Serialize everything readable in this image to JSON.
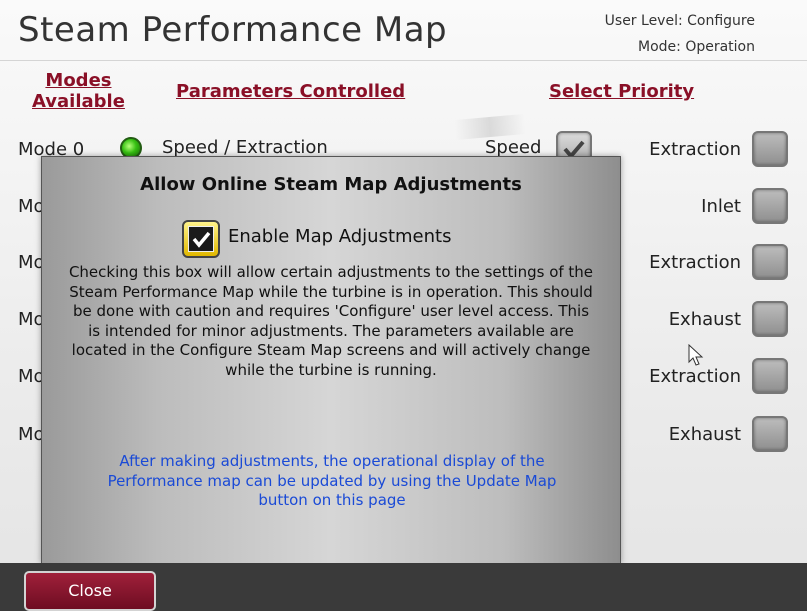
{
  "header": {
    "title": "Steam Performance Map",
    "user_level": "User Level: Configure",
    "mode": "Mode: Operation"
  },
  "columns": {
    "modes_line1": "Modes",
    "modes_line2": "Available",
    "parameters": "Parameters Controlled",
    "priority": "Select Priority"
  },
  "rows": [
    {
      "label": "Mode 0",
      "parameters": "Speed / Extraction",
      "speed": "Speed",
      "priority": "Extraction"
    },
    {
      "label": "Mo",
      "priority": "Inlet"
    },
    {
      "label": "Mo",
      "priority": "Extraction"
    },
    {
      "label": "Mo",
      "priority": "Exhaust"
    },
    {
      "label": "Mo",
      "priority": "Extraction"
    },
    {
      "label": "Mo",
      "priority": "Exhaust"
    }
  ],
  "modal": {
    "title": "Allow Online Steam Map Adjustments",
    "enable_label": "Enable Map Adjustments",
    "enable_checked": true,
    "description_lines": [
      "Checking this box will allow certain adjustments to the settings of the",
      "Steam Performance Map while the turbine is in operation.  This should",
      "be done with caution and requires 'Configure' user level access.  This",
      "is intended for minor adjustments.  The parameters available are",
      "located in the Configure Steam Map screens and will actively change",
      "while the turbine is running."
    ],
    "note_lines": [
      "After making adjustments, the operational display of the",
      "Performance map can be updated by using the Update Map",
      "button on this page"
    ]
  },
  "footer": {
    "close_label": "Close"
  },
  "colors": {
    "link": "#8a1027",
    "note": "#1a4ad6",
    "close_button": "#8a1530",
    "checkbox_accent": "#f0d400"
  }
}
